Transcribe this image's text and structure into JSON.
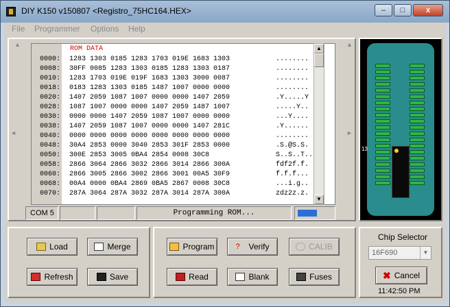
{
  "window": {
    "title": "DIY K150 v150807  <Registro_75HC164.HEX>",
    "minimize": "–",
    "maximize": "□",
    "close": "x"
  },
  "menu": [
    "File",
    "Programmer",
    "Options",
    "Help"
  ],
  "editor": {
    "header": "ROM DATA",
    "rows": [
      {
        "addr": "0000:",
        "hex": "1283 1303 0185 1283 1703 019E 1683 1303",
        "ascii": "........"
      },
      {
        "addr": "0008:",
        "hex": "30FF 0085 1283 1303 0185 1283 1303 0187",
        "ascii": "........"
      },
      {
        "addr": "0010:",
        "hex": "1283 1703 019E 019F 1683 1303 3000 0087",
        "ascii": "........"
      },
      {
        "addr": "0018:",
        "hex": "0183 1283 1303 0185 1487 1007 0000 0000",
        "ascii": "........"
      },
      {
        "addr": "0020:",
        "hex": "1407 2059 1087 1007 0000 0000 1407 2059",
        "ascii": ".Y.....Y"
      },
      {
        "addr": "0028:",
        "hex": "1087 1007 0000 0000 1407 2059 1487 1007",
        "ascii": ".....Y.."
      },
      {
        "addr": "0030:",
        "hex": "0000 0000 1407 2059 1087 1007 0000 0000",
        "ascii": "...Y...."
      },
      {
        "addr": "0038:",
        "hex": "1407 2059 1087 1007 0000 0000 1407 281C",
        "ascii": ".Y......"
      },
      {
        "addr": "0040:",
        "hex": "0000 0000 0000 0000 0000 0000 0000 0000",
        "ascii": "........"
      },
      {
        "addr": "0048:",
        "hex": "30A4 2853 0000 3040 2853 301F 2853 0000",
        "ascii": ".S.@S.S."
      },
      {
        "addr": "0050:",
        "hex": "300E 2853 3005 0BA4 2854 0008 30C8 ",
        "ascii": "S..S..T.."
      },
      {
        "addr": "0058:",
        "hex": "2866 3064 2866 3032 2866 3014 2866 300A",
        "ascii": "fdf2f.f."
      },
      {
        "addr": "0060:",
        "hex": "2866 3005 2866 3002 2866 3001 00A5 30F9",
        "ascii": "f.f.f..."
      },
      {
        "addr": "0068:",
        "hex": "00A4 0000 0BA4 2869 0BA5 2867 0008 30C8",
        "ascii": "...i.g.."
      },
      {
        "addr": "0070:",
        "hex": "287A 3064 287A 3032 287A 3014 287A 300A",
        "ascii": "zdz2z.z."
      }
    ]
  },
  "status": {
    "port": "COM 5",
    "message": "Programming ROM...",
    "progress": 0.55
  },
  "socket": {
    "pin_marker": "13"
  },
  "buttons": {
    "load": "Load",
    "merge": "Merge",
    "refresh": "Refresh",
    "save": "Save",
    "program": "Program",
    "verify": "Verify",
    "calib": "CALIB",
    "read": "Read",
    "blank": "Blank",
    "fuses": "Fuses",
    "cancel": "Cancel"
  },
  "chip_selector": {
    "label": "Chip Selector",
    "value": "16F690"
  },
  "clock": "11:42:50 PM",
  "colors": {
    "board": "#2a8c8c",
    "chip": "#0a0a0a",
    "pins": "#2fb54a",
    "error_red": "#cc0000"
  }
}
